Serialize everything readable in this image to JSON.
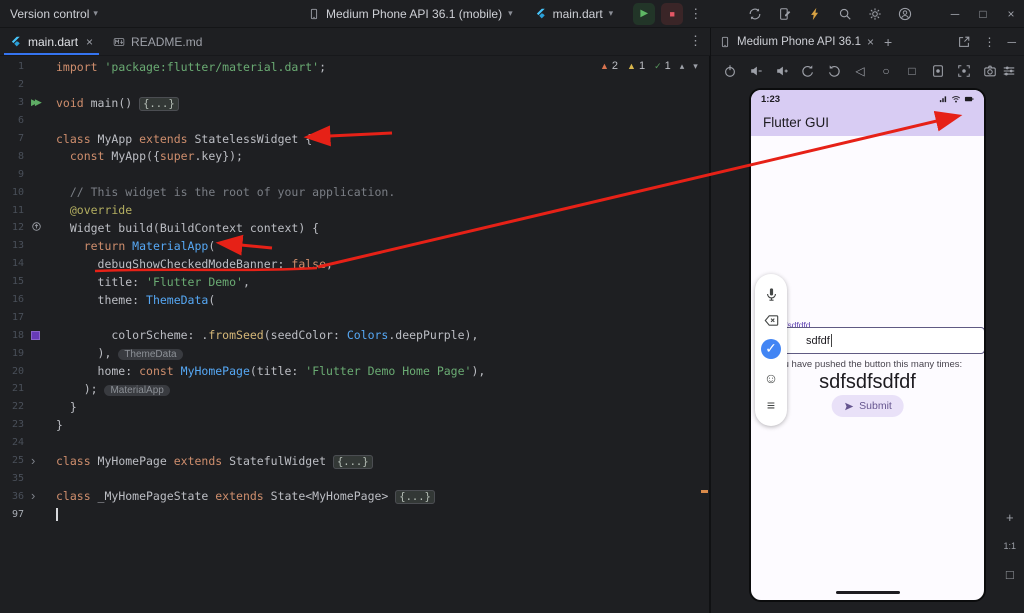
{
  "topbar": {
    "version_control": "Version control",
    "device_selector": "Medium Phone API 36.1 (mobile)",
    "run_config": "main.dart",
    "right_icons": [
      "sync-icon",
      "device-edit-icon",
      "bolt-icon",
      "search-icon",
      "settings-icon",
      "avatar-icon"
    ],
    "window_controls": [
      "minimize-icon",
      "maximize-icon",
      "close-icon"
    ]
  },
  "editor_tabs": {
    "tabs": [
      {
        "label": "main.dart",
        "icon": "flutter-icon",
        "active": true,
        "closable": true
      },
      {
        "label": "README.md",
        "icon": "markdown-icon",
        "active": false,
        "closable": false
      }
    ]
  },
  "editor": {
    "inspections": [
      {
        "name": "error-badge",
        "glyph": "▲",
        "count": "2",
        "color": "#d9734f"
      },
      {
        "name": "warning-badge",
        "glyph": "▲",
        "count": "1",
        "color": "#d8b64c"
      },
      {
        "name": "passed-badge",
        "glyph": "✓",
        "count": "1",
        "color": "#57965c"
      }
    ],
    "nav_prev": "▴",
    "nav_next": "▾",
    "lines": [
      {
        "n": "1",
        "seg": [
          [
            "k",
            "import "
          ],
          [
            "s",
            "'package:flutter/material.dart'"
          ],
          [
            "p",
            ";"
          ]
        ]
      },
      {
        "n": "2",
        "seg": []
      },
      {
        "n": "3",
        "icon": "run-icon",
        "seg": [
          [
            "k",
            "void "
          ],
          [
            "p",
            "main() "
          ],
          [
            "F",
            "{...}"
          ]
        ]
      },
      {
        "n": "6",
        "seg": []
      },
      {
        "n": "7",
        "seg": [
          [
            "k",
            "class "
          ],
          [
            "p",
            "MyApp "
          ],
          [
            "k",
            "extends "
          ],
          [
            "p",
            "StatelessWidget {"
          ]
        ]
      },
      {
        "n": "8",
        "seg": [
          [
            "p",
            "  "
          ],
          [
            "k",
            "const "
          ],
          [
            "p",
            "MyApp({"
          ],
          [
            "k",
            "super"
          ],
          [
            "p",
            ".key});"
          ]
        ]
      },
      {
        "n": "9",
        "seg": []
      },
      {
        "n": "10",
        "seg": [
          [
            "c",
            "  // This widget is the root of your application."
          ]
        ]
      },
      {
        "n": "11",
        "seg": [
          [
            "a",
            "  @override"
          ]
        ]
      },
      {
        "n": "12",
        "icon": "override-icon",
        "seg": [
          [
            "p",
            "  Widget build(BuildContext context) {"
          ]
        ]
      },
      {
        "n": "13",
        "seg": [
          [
            "p",
            "    "
          ],
          [
            "k",
            "return "
          ],
          [
            "T",
            "MaterialApp"
          ],
          [
            "p",
            "("
          ]
        ]
      },
      {
        "n": "14",
        "seg": [
          [
            "p",
            "      debugShowCheckedModeBanner: "
          ],
          [
            "k",
            "false"
          ],
          [
            "p",
            ","
          ]
        ]
      },
      {
        "n": "15",
        "seg": [
          [
            "p",
            "      title: "
          ],
          [
            "s",
            "'Flutter Demo'"
          ],
          [
            "p",
            ","
          ]
        ]
      },
      {
        "n": "16",
        "seg": [
          [
            "p",
            "      theme: "
          ],
          [
            "T",
            "ThemeData"
          ],
          [
            "p",
            "("
          ]
        ]
      },
      {
        "n": "17",
        "seg": []
      },
      {
        "n": "18",
        "icon": "color-swatch",
        "seg": [
          [
            "p",
            "        colorScheme: ."
          ],
          [
            "f",
            "fromSeed"
          ],
          [
            "p",
            "(seedColor: "
          ],
          [
            "T",
            "Colors"
          ],
          [
            "p",
            ".deepPurple),"
          ]
        ]
      },
      {
        "n": "19",
        "seg": [
          [
            "p",
            "      ), "
          ],
          [
            "H",
            "ThemeData"
          ]
        ]
      },
      {
        "n": "20",
        "seg": [
          [
            "p",
            "      home: "
          ],
          [
            "k",
            "const "
          ],
          [
            "T",
            "MyHomePage"
          ],
          [
            "p",
            "(title: "
          ],
          [
            "s",
            "'Flutter Demo Home Page'"
          ],
          [
            "p",
            "),"
          ]
        ]
      },
      {
        "n": "21",
        "seg": [
          [
            "p",
            "    ); "
          ],
          [
            "H",
            "MaterialApp"
          ]
        ]
      },
      {
        "n": "22",
        "seg": [
          [
            "p",
            "  }"
          ]
        ]
      },
      {
        "n": "23",
        "seg": [
          [
            "p",
            "}"
          ]
        ]
      },
      {
        "n": "24",
        "seg": []
      },
      {
        "n": "25",
        "icon": "fold-icon",
        "seg": [
          [
            "k",
            "class "
          ],
          [
            "p",
            "MyHomePage "
          ],
          [
            "k",
            "extends "
          ],
          [
            "p",
            "StatefulWidget "
          ],
          [
            "F",
            "{...}"
          ]
        ]
      },
      {
        "n": "35",
        "seg": []
      },
      {
        "n": "36",
        "icon": "fold-icon",
        "seg": [
          [
            "k",
            "class "
          ],
          [
            "p",
            "_MyHomePageState "
          ],
          [
            "k",
            "extends "
          ],
          [
            "p",
            "State<MyHomePage> "
          ],
          [
            "F",
            "{...}"
          ]
        ]
      },
      {
        "n": "97",
        "caret": true,
        "seg": []
      }
    ]
  },
  "device_panel": {
    "tab": {
      "title": "Medium Phone API 36.1"
    },
    "tab_actions": [
      "open-window-icon",
      "more-vert-icon",
      "hide-icon"
    ],
    "toolbar": [
      "power-icon",
      "volume-down-icon",
      "volume-up-icon",
      "rotate-left-icon",
      "rotate-right-icon",
      "back-icon",
      "home-icon",
      "overview-icon",
      "record-icon",
      "screenshot-icon",
      "camera-icon"
    ],
    "toolbar_right": [
      "sliders-icon"
    ],
    "zoom": {
      "zoom_in": "+",
      "fit": "1:1",
      "reset": "□"
    },
    "emulator": {
      "status_time": "1:23",
      "status_icons": [
        "signal-icon",
        "wifi-icon",
        "battery-icon"
      ],
      "app_bar_title": "Flutter GUI",
      "input_toolbar": [
        "mic-icon",
        "backspace-icon",
        "check-icon",
        "smiley-icon",
        "menu-icon"
      ],
      "text_field": {
        "label": "sdfsdfdfd",
        "value": "sdfdf"
      },
      "caption": "You have pushed the button this many times:",
      "counter": "sdfsdfsdfdf",
      "submit": {
        "label": "Submit",
        "icon": "send-icon"
      }
    }
  }
}
